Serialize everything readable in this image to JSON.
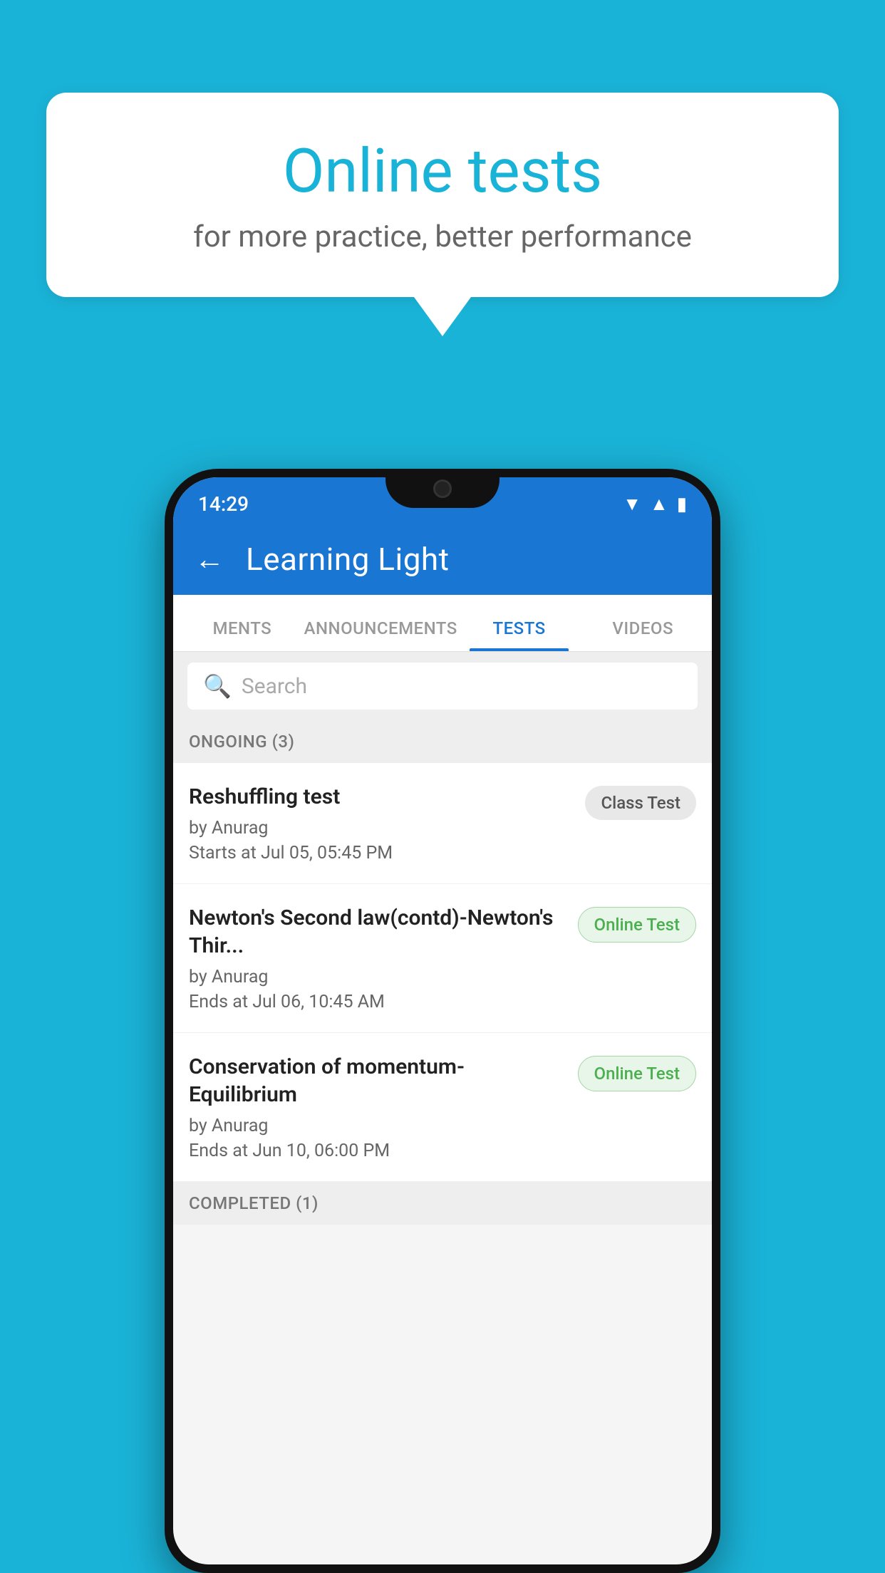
{
  "background_color": "#1ab3d8",
  "speech_bubble": {
    "title": "Online tests",
    "subtitle": "for more practice, better performance"
  },
  "phone": {
    "status_bar": {
      "time": "14:29",
      "icons": [
        "wifi",
        "signal",
        "battery"
      ]
    },
    "header": {
      "back_label": "←",
      "title": "Learning Light"
    },
    "tabs": [
      {
        "label": "MENTS",
        "active": false
      },
      {
        "label": "ANNOUNCEMENTS",
        "active": false
      },
      {
        "label": "TESTS",
        "active": true
      },
      {
        "label": "VIDEOS",
        "active": false
      }
    ],
    "search": {
      "placeholder": "Search"
    },
    "ongoing_section": {
      "label": "ONGOING (3)",
      "tests": [
        {
          "name": "Reshuffling test",
          "author": "by Anurag",
          "date": "Starts at  Jul 05, 05:45 PM",
          "badge": "Class Test",
          "badge_type": "class"
        },
        {
          "name": "Newton's Second law(contd)-Newton's Thir...",
          "author": "by Anurag",
          "date": "Ends at  Jul 06, 10:45 AM",
          "badge": "Online Test",
          "badge_type": "online"
        },
        {
          "name": "Conservation of momentum-Equilibrium",
          "author": "by Anurag",
          "date": "Ends at  Jun 10, 06:00 PM",
          "badge": "Online Test",
          "badge_type": "online"
        }
      ]
    },
    "completed_section": {
      "label": "COMPLETED (1)"
    }
  }
}
